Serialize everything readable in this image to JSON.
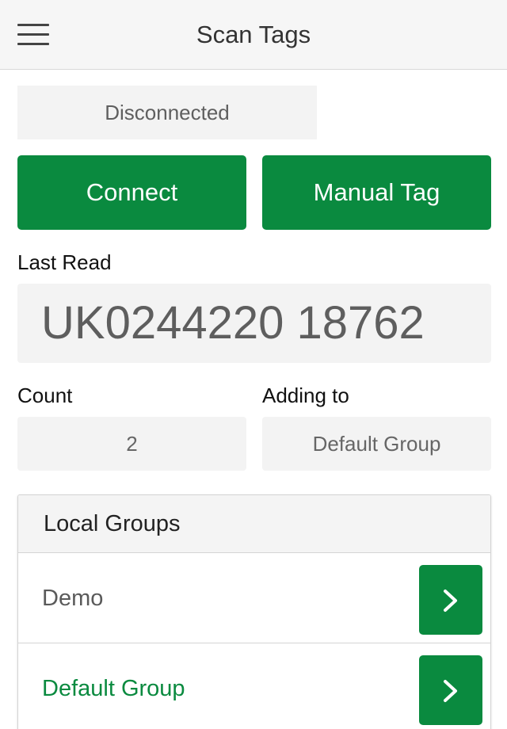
{
  "header": {
    "title": "Scan Tags",
    "menu_icon": "hamburger-menu-icon"
  },
  "status": {
    "text": "Disconnected"
  },
  "actions": {
    "connect_label": "Connect",
    "manual_tag_label": "Manual Tag"
  },
  "last_read": {
    "label": "Last Read",
    "value": "UK0244220 18762"
  },
  "count": {
    "label": "Count",
    "value": "2"
  },
  "adding_to": {
    "label": "Adding to",
    "value": "Default Group"
  },
  "local_groups": {
    "title": "Local Groups",
    "items": [
      {
        "name": "Demo",
        "icon": "chevron-right-icon"
      },
      {
        "name": "Default Group",
        "icon": "chevron-right-icon"
      }
    ]
  },
  "colors": {
    "accent": "#0a8a3f",
    "field_bg": "#f3f3f3",
    "header_bg": "#f6f6f6"
  }
}
